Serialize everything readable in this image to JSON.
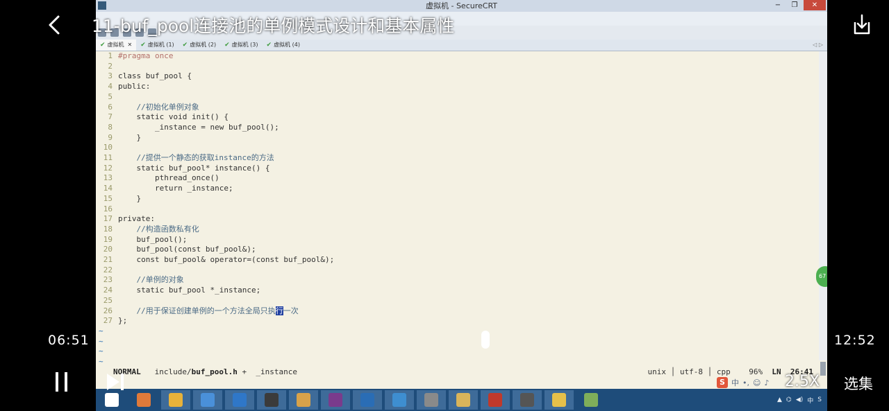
{
  "player": {
    "title": "11-buf_pool连接池的单例模式设计和基本属性",
    "current_time": "06:51",
    "total_time": "12:52",
    "speed": "2.5X",
    "episodes_label": "选集",
    "progress_fraction": 0.53
  },
  "window": {
    "title": "虚拟机 - SecureCRT",
    "tabs": [
      {
        "label": "虚拟机"
      },
      {
        "label": "虚拟机 (1)"
      },
      {
        "label": "虚拟机 (2)"
      },
      {
        "label": "虚拟机 (3)"
      },
      {
        "label": "虚拟机 (4)"
      }
    ]
  },
  "editor": {
    "lines": [
      {
        "n": "1",
        "text": "#pragma once"
      },
      {
        "n": "2",
        "text": ""
      },
      {
        "n": "3",
        "text": "class buf_pool {"
      },
      {
        "n": "4",
        "text": "public:"
      },
      {
        "n": "5",
        "text": ""
      },
      {
        "n": "6",
        "text": "    //初始化单例对象"
      },
      {
        "n": "7",
        "text": "    static void init() {"
      },
      {
        "n": "8",
        "text": "        _instance = new buf_pool();"
      },
      {
        "n": "9",
        "text": "    }"
      },
      {
        "n": "10",
        "text": ""
      },
      {
        "n": "11",
        "text": "    //提供一个静态的获取instance的方法"
      },
      {
        "n": "12",
        "text": "    static buf_pool* instance() {"
      },
      {
        "n": "13",
        "text": "        pthread_once()"
      },
      {
        "n": "14",
        "text": "        return _instance;"
      },
      {
        "n": "15",
        "text": "    }"
      },
      {
        "n": "16",
        "text": ""
      },
      {
        "n": "17",
        "text": "private:"
      },
      {
        "n": "18",
        "text": "    //构造函数私有化"
      },
      {
        "n": "19",
        "text": "    buf_pool();"
      },
      {
        "n": "20",
        "text": "    buf_pool(const buf_pool&);"
      },
      {
        "n": "21",
        "text": "    const buf_pool& operator=(const buf_pool&);"
      },
      {
        "n": "22",
        "text": ""
      },
      {
        "n": "23",
        "text": "    //单例的对象"
      },
      {
        "n": "24",
        "text": "    static buf_pool *_instance;"
      },
      {
        "n": "25",
        "text": ""
      },
      {
        "n": "26",
        "text": "    //用于保证创建单例的一个方法全局只执行一次"
      },
      {
        "n": "27",
        "text": "};"
      }
    ],
    "tilde_rows": 4
  },
  "statusline": {
    "mode": "NORMAL",
    "path_prefix": "include/",
    "file": "buf_pool.h",
    "modified": "+",
    "symbol": "_instance",
    "fileformat": "unix",
    "encoding": "utf-8",
    "filetype": "cpp",
    "percent": "96%",
    "ln_label": "LN",
    "position": "26:41"
  },
  "ime": {
    "label": "中"
  },
  "colors": {
    "editor_bg": "#f4f1e3",
    "taskbar_bg": "#1e4c7a",
    "keyword": "#4b6b86",
    "function": "#4fa4a9",
    "preproc": "#b3706a"
  },
  "taskbar_icons": [
    "windows-start-icon",
    "app-icon",
    "chrome-icon",
    "computer-icon",
    "vscode-icon",
    "goland-icon",
    "paint-icon",
    "onenote-icon",
    "shark-icon",
    "feather-icon",
    "securecrt-icon",
    "folder-icon",
    "xshell-icon",
    "typora-icon",
    "chat-icon",
    "screen-icon"
  ]
}
